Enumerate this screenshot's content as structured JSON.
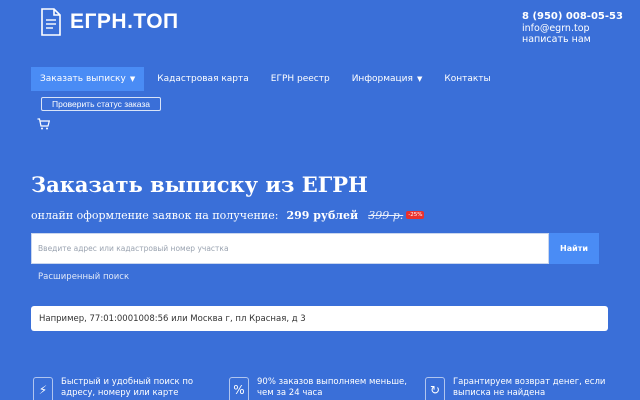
{
  "header": {
    "logo_text": "ЕГРН.ТОП",
    "phone": "8 (950) 008-05-53",
    "email": "info@egrn.top",
    "write_us": "написать нам"
  },
  "nav": [
    {
      "label": "Заказать выписку",
      "dropdown": true,
      "active": true
    },
    {
      "label": "Кадастровая карта",
      "dropdown": false
    },
    {
      "label": "ЕГРН реестр",
      "dropdown": false
    },
    {
      "label": "Информация",
      "dropdown": true
    },
    {
      "label": "Контакты",
      "dropdown": false
    }
  ],
  "status_button": "Проверить статус заказа",
  "cart_icon": "cart-icon",
  "hero": {
    "title": "Заказать выписку из ЕГРН",
    "subtitle": "онлайн оформление заявок на получение:",
    "price": "299 рублей",
    "old_price": "399 р.",
    "discount": "-25%"
  },
  "search": {
    "placeholder": "Введите адрес или кадастровый номер участка",
    "button": "Найти",
    "advanced": "Расширенный поиск"
  },
  "example": "Например, 77:01:0001008:56 или Москва г, пл Красная, д 3",
  "features": [
    {
      "icon": "lightning-icon",
      "line1": "Быстрый и удобный поиск по",
      "line2": "адресу, номеру или карте"
    },
    {
      "icon": "percent-icon",
      "line1": "90% заказов выполняем меньше,",
      "line2": "чем за 24 часа"
    },
    {
      "icon": "refresh-icon",
      "line1": "Гарантируем возврат денег, если",
      "line2": "выписка не найдена"
    }
  ],
  "colors": {
    "background": "#3a6fd8",
    "accent": "#4a8cf5",
    "discount": "#e8312f"
  }
}
